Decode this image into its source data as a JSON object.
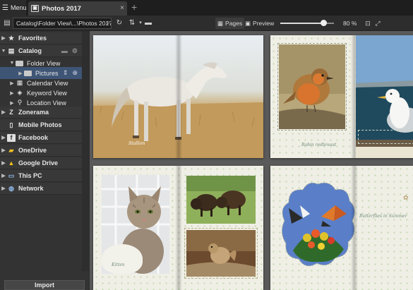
{
  "titlebar": {
    "menu_label": "Menu",
    "tab_title": "Photos 2017",
    "close_glyph": "×",
    "new_tab_glyph": "+"
  },
  "toolbar": {
    "path": "Catalog\\Folder View\\...\\Photos 2017",
    "pages_label": "Pages",
    "preview_label": "Preview",
    "zoom_level": 80,
    "zoom_text": "80 %"
  },
  "sidebar": {
    "favorites": "Favorites",
    "catalog": "Catalog",
    "folder_view": "Folder View",
    "pictures": "Pictures",
    "calendar_view": "Calendar View",
    "keyword_view": "Keyword View",
    "location_view": "Location View",
    "zonerama": "Zonerama",
    "mobile_photos": "Mobile Photos",
    "facebook": "Facebook",
    "onedrive": "OneDrive",
    "google_drive": "Google Drive",
    "this_pc": "This PC",
    "network": "Network",
    "import_label": "Import"
  },
  "pages": {
    "horse_caption": "Stallion",
    "robin_caption": "Robin redbreast",
    "kitten_caption": "Kitten",
    "butterfly_caption": "Butterflies in Summer"
  },
  "colors": {
    "accent_selected": "#3f5576",
    "background": "#3a3a3a",
    "content_bg": "#5a5a5a"
  }
}
